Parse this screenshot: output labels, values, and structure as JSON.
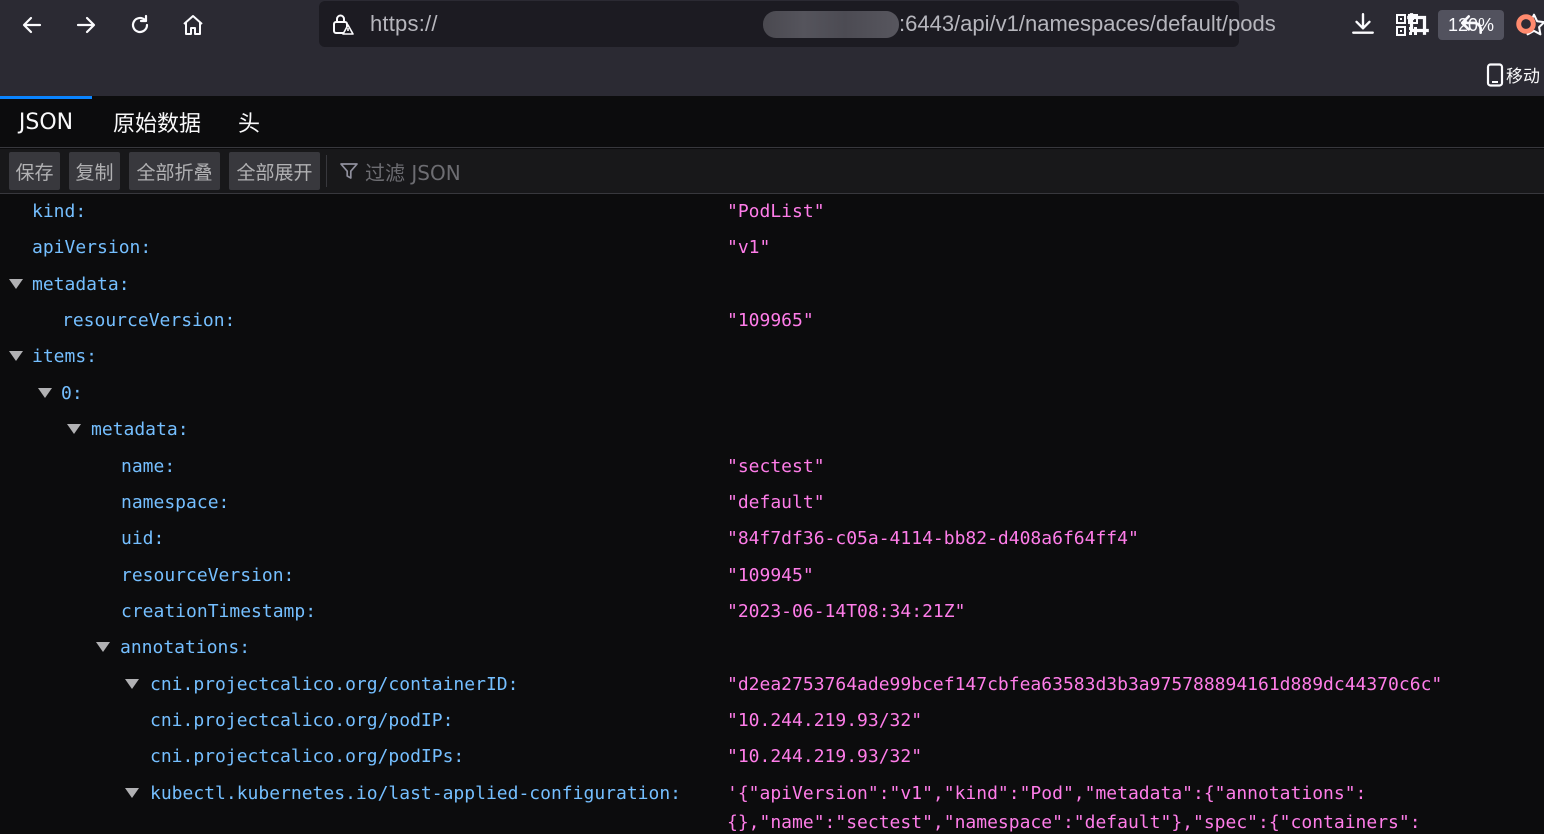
{
  "browser": {
    "url_prefix": "https://",
    "url_suffix": ":6443/api/v1/namespaces/default/pods",
    "zoom": "120%",
    "mobile_label": "移动"
  },
  "tabs": [
    {
      "label": "JSON",
      "active": true
    },
    {
      "label": "原始数据",
      "active": false
    },
    {
      "label": "头",
      "active": false
    }
  ],
  "toolbar": {
    "save": "保存",
    "copy": "复制",
    "collapse_all": "全部折叠",
    "expand_all": "全部展开",
    "filter_placeholder": "过滤 JSON"
  },
  "rows": [
    {
      "key": "kind:",
      "value": "\"PodList\""
    },
    {
      "key": "apiVersion:",
      "value": "\"v1\""
    },
    {
      "key": "metadata:",
      "value": ""
    },
    {
      "key": "resourceVersion:",
      "value": "\"109965\""
    },
    {
      "key": "items:",
      "value": ""
    },
    {
      "key": "0:",
      "value": ""
    },
    {
      "key": "metadata:",
      "value": ""
    },
    {
      "key": "name:",
      "value": "\"sectest\""
    },
    {
      "key": "namespace:",
      "value": "\"default\""
    },
    {
      "key": "uid:",
      "value": "\"84f7df36-c05a-4114-bb82-d408a6f64ff4\""
    },
    {
      "key": "resourceVersion:",
      "value": "\"109945\""
    },
    {
      "key": "creationTimestamp:",
      "value": "\"2023-06-14T08:34:21Z\""
    },
    {
      "key": "annotations:",
      "value": ""
    },
    {
      "key": "cni.projectcalico.org/containerID:",
      "value": "\"d2ea2753764ade99bcef147cbfea63583d3b3a975788894161d889dc44370c6c\""
    },
    {
      "key": "cni.projectcalico.org/podIP:",
      "value": "\"10.244.219.93/32\""
    },
    {
      "key": "cni.projectcalico.org/podIPs:",
      "value": "\"10.244.219.93/32\""
    },
    {
      "key": "kubectl.kubernetes.io/last-applied-configuration:",
      "value": "'{\"apiVersion\":\"v1\",\"kind\":\"Pod\",\"metadata\":{\"annotations\":",
      "value_cont": "{},\"name\":\"sectest\",\"namespace\":\"default\"},\"spec\":{\"containers\":"
    }
  ]
}
